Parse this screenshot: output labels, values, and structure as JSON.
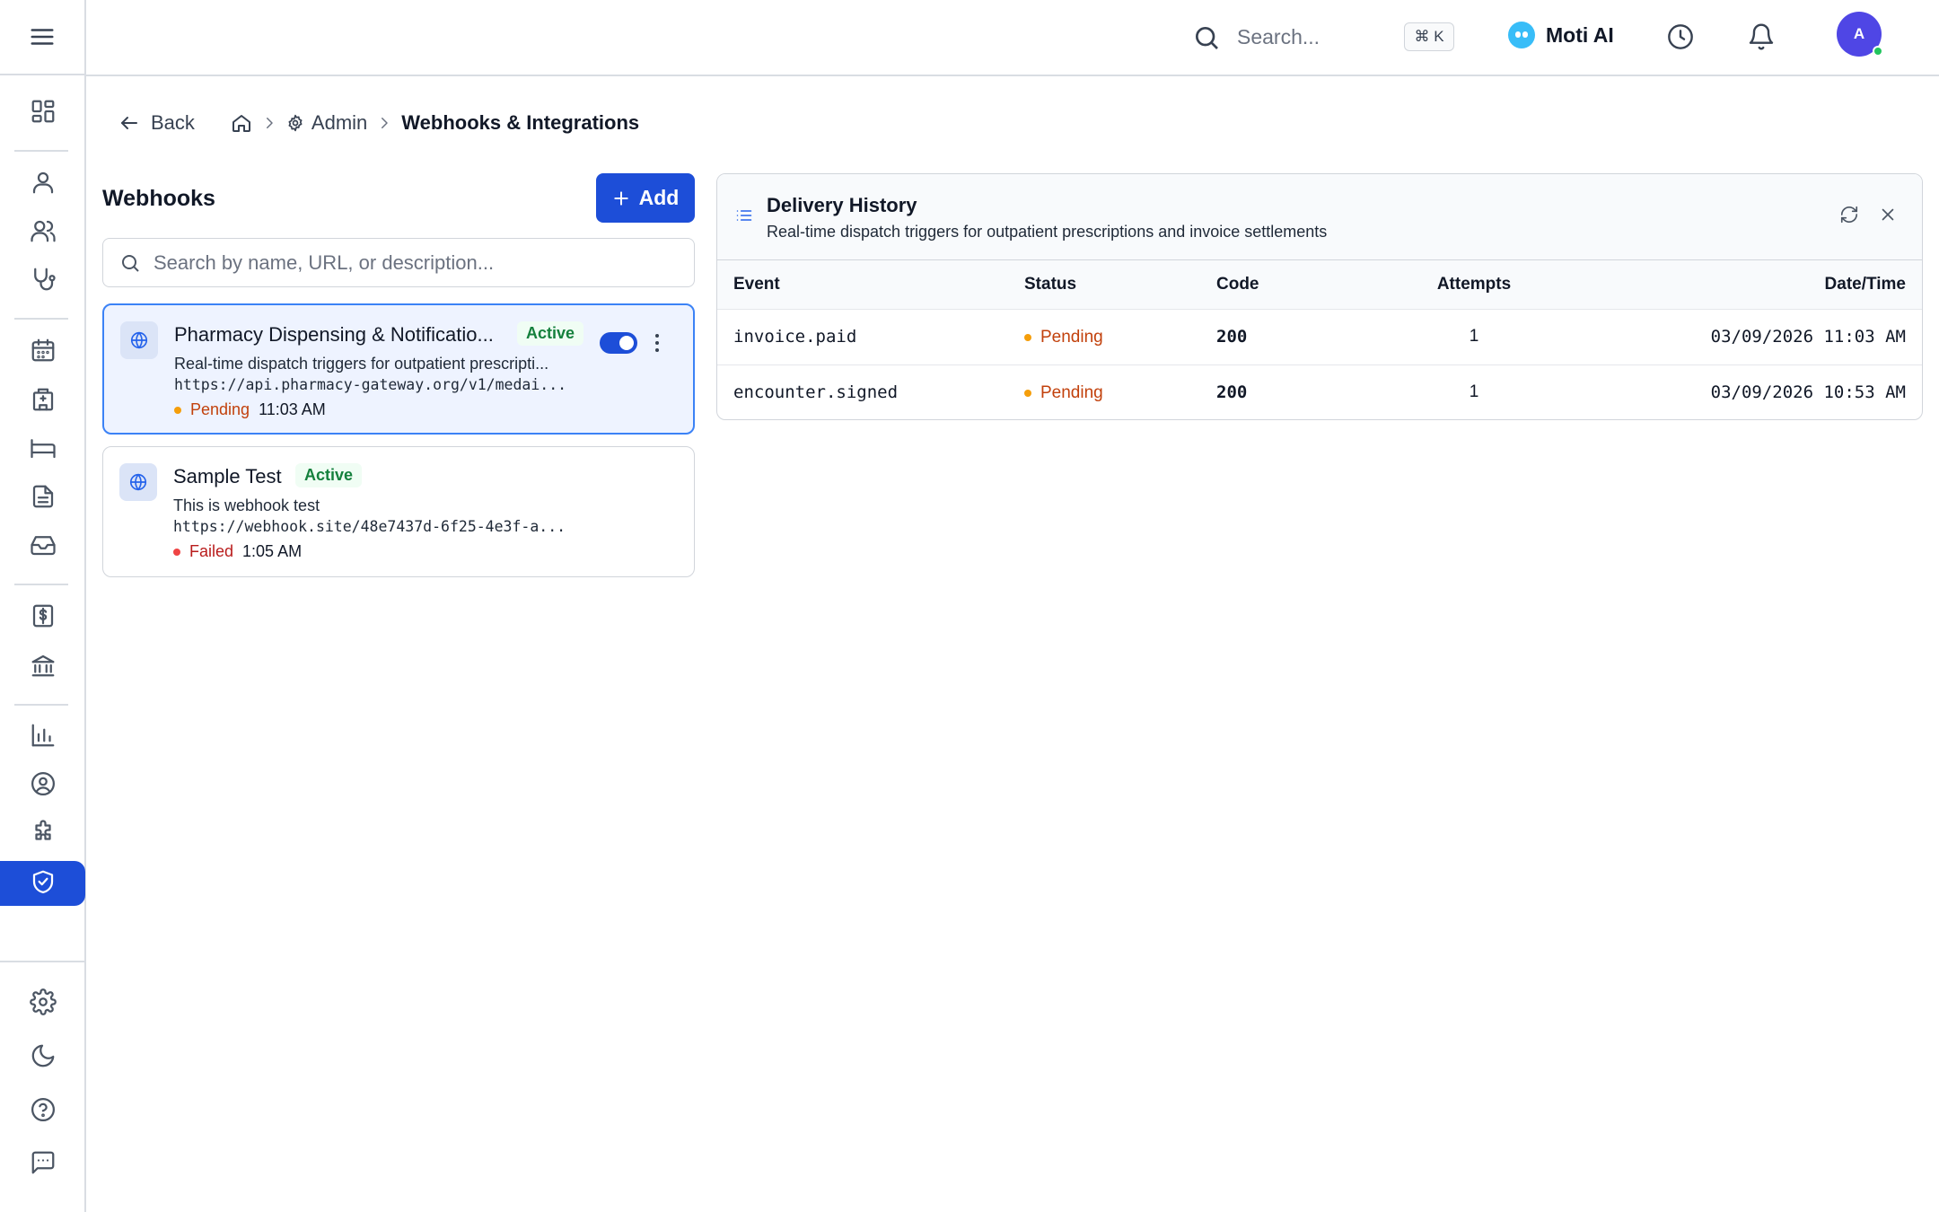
{
  "header": {
    "search_placeholder": "Search...",
    "shortcut": "⌘ K",
    "assistant_label": "Moti AI",
    "avatar_initial": "A"
  },
  "breadcrumb": {
    "back_label": "Back",
    "admin_label": "Admin",
    "current_label": "Webhooks & Integrations"
  },
  "webhooks": {
    "title": "Webhooks",
    "add_label": "Add",
    "search_placeholder": "Search by name, URL, or description...",
    "items": [
      {
        "name": "Pharmacy Dispensing & Notificatio...",
        "badge": "Active",
        "description": "Real-time dispatch triggers for outpatient prescripti...",
        "url": "https://api.pharmacy-gateway.org/v1/medai...",
        "status": "Pending",
        "time": "11:03 AM",
        "enabled": true,
        "selected": true
      },
      {
        "name": "Sample Test",
        "badge": "Active",
        "description": "This is webhook test",
        "url": "https://webhook.site/48e7437d-6f25-4e3f-a...",
        "status": "Failed",
        "time": "1:05 AM",
        "selected": false
      }
    ]
  },
  "delivery_history": {
    "title": "Delivery History",
    "subtitle": "Real-time dispatch triggers for outpatient prescriptions and invoice settlements",
    "columns": [
      "Event",
      "Status",
      "Code",
      "Attempts",
      "Date/Time"
    ],
    "rows": [
      {
        "event": "invoice.paid",
        "status": "Pending",
        "code": "200",
        "attempts": "1",
        "datetime": "03/09/2026 11:03 AM"
      },
      {
        "event": "encounter.signed",
        "status": "Pending",
        "code": "200",
        "attempts": "1",
        "datetime": "03/09/2026 10:53 AM"
      }
    ]
  },
  "colors": {
    "primary": "#1d4ed8",
    "pending": "#c2410c",
    "pending_dot": "#f59e0b",
    "failed": "#b91c1c",
    "failed_dot": "#ef4444",
    "success_code": "#059669",
    "active_badge": "#15803d"
  },
  "sidebar": {
    "icons": [
      "menu-icon",
      "dashboard-icon",
      "user-icon",
      "users-icon",
      "stethoscope-icon",
      "calendar-icon",
      "hospital-icon",
      "bed-icon",
      "document-icon",
      "inbox-icon",
      "billing-icon",
      "bank-icon",
      "chart-icon",
      "profile-icon",
      "puzzle-icon",
      "shield-check-icon",
      "settings-icon",
      "moon-icon",
      "help-icon",
      "chat-icon"
    ],
    "active": "shield-check-icon"
  }
}
